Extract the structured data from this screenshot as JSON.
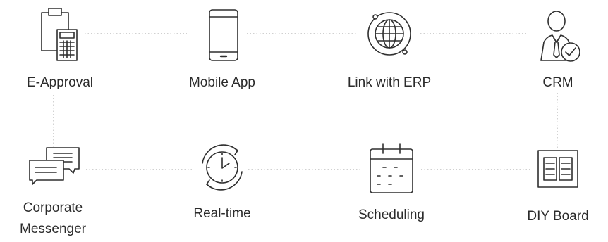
{
  "features": {
    "e_approval": {
      "label": "E-Approval",
      "icon": "clipboard-calculator-icon"
    },
    "mobile_app": {
      "label": "Mobile App",
      "icon": "smartphone-icon"
    },
    "link_erp": {
      "label": "Link with ERP",
      "icon": "globe-orbit-icon"
    },
    "crm": {
      "label": "CRM",
      "icon": "user-check-icon"
    },
    "messenger": {
      "label_line1": "Corporate",
      "label_line2": "Messenger",
      "icon": "chat-bubbles-icon"
    },
    "realtime": {
      "label": "Real-time",
      "icon": "clock-sync-icon"
    },
    "scheduling": {
      "label": "Scheduling",
      "icon": "calendar-icon"
    },
    "diy_board": {
      "label": "DIY Board",
      "icon": "board-icon"
    }
  },
  "colors": {
    "stroke": "#2f2f2f",
    "connector": "#b5b5b5",
    "text": "#2b2b2b"
  }
}
